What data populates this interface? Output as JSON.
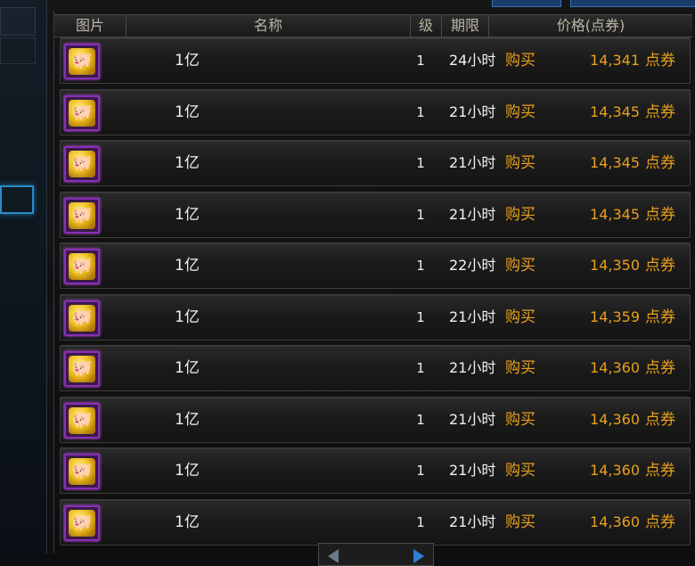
{
  "header": {
    "col_image": "图片",
    "col_name": "名称",
    "col_level": "级",
    "col_duration": "期限",
    "col_price": "价格(点券)"
  },
  "items": [
    {
      "name": "1亿",
      "level": "1",
      "duration": "24小时",
      "buy_label": "购买",
      "price": "14,341",
      "unit": "点券"
    },
    {
      "name": "1亿",
      "level": "1",
      "duration": "21小时",
      "buy_label": "购买",
      "price": "14,345",
      "unit": "点券"
    },
    {
      "name": "1亿",
      "level": "1",
      "duration": "21小时",
      "buy_label": "购买",
      "price": "14,345",
      "unit": "点券"
    },
    {
      "name": "1亿",
      "level": "1",
      "duration": "21小时",
      "buy_label": "购买",
      "price": "14,345",
      "unit": "点券"
    },
    {
      "name": "1亿",
      "level": "1",
      "duration": "22小时",
      "buy_label": "购买",
      "price": "14,350",
      "unit": "点券"
    },
    {
      "name": "1亿",
      "level": "1",
      "duration": "21小时",
      "buy_label": "购买",
      "price": "14,359",
      "unit": "点券"
    },
    {
      "name": "1亿",
      "level": "1",
      "duration": "21小时",
      "buy_label": "购买",
      "price": "14,360",
      "unit": "点券"
    },
    {
      "name": "1亿",
      "level": "1",
      "duration": "21小时",
      "buy_label": "购买",
      "price": "14,360",
      "unit": "点券"
    },
    {
      "name": "1亿",
      "level": "1",
      "duration": "21小时",
      "buy_label": "购买",
      "price": "14,360",
      "unit": "点券"
    },
    {
      "name": "1亿",
      "level": "1",
      "duration": "21小时",
      "buy_label": "购买",
      "price": "14,360",
      "unit": "点券"
    }
  ],
  "item_icon": "gold-piggy-bank-icon",
  "colors": {
    "price_accent": "#e8a01c",
    "icon_border": "#8a2fb5"
  }
}
